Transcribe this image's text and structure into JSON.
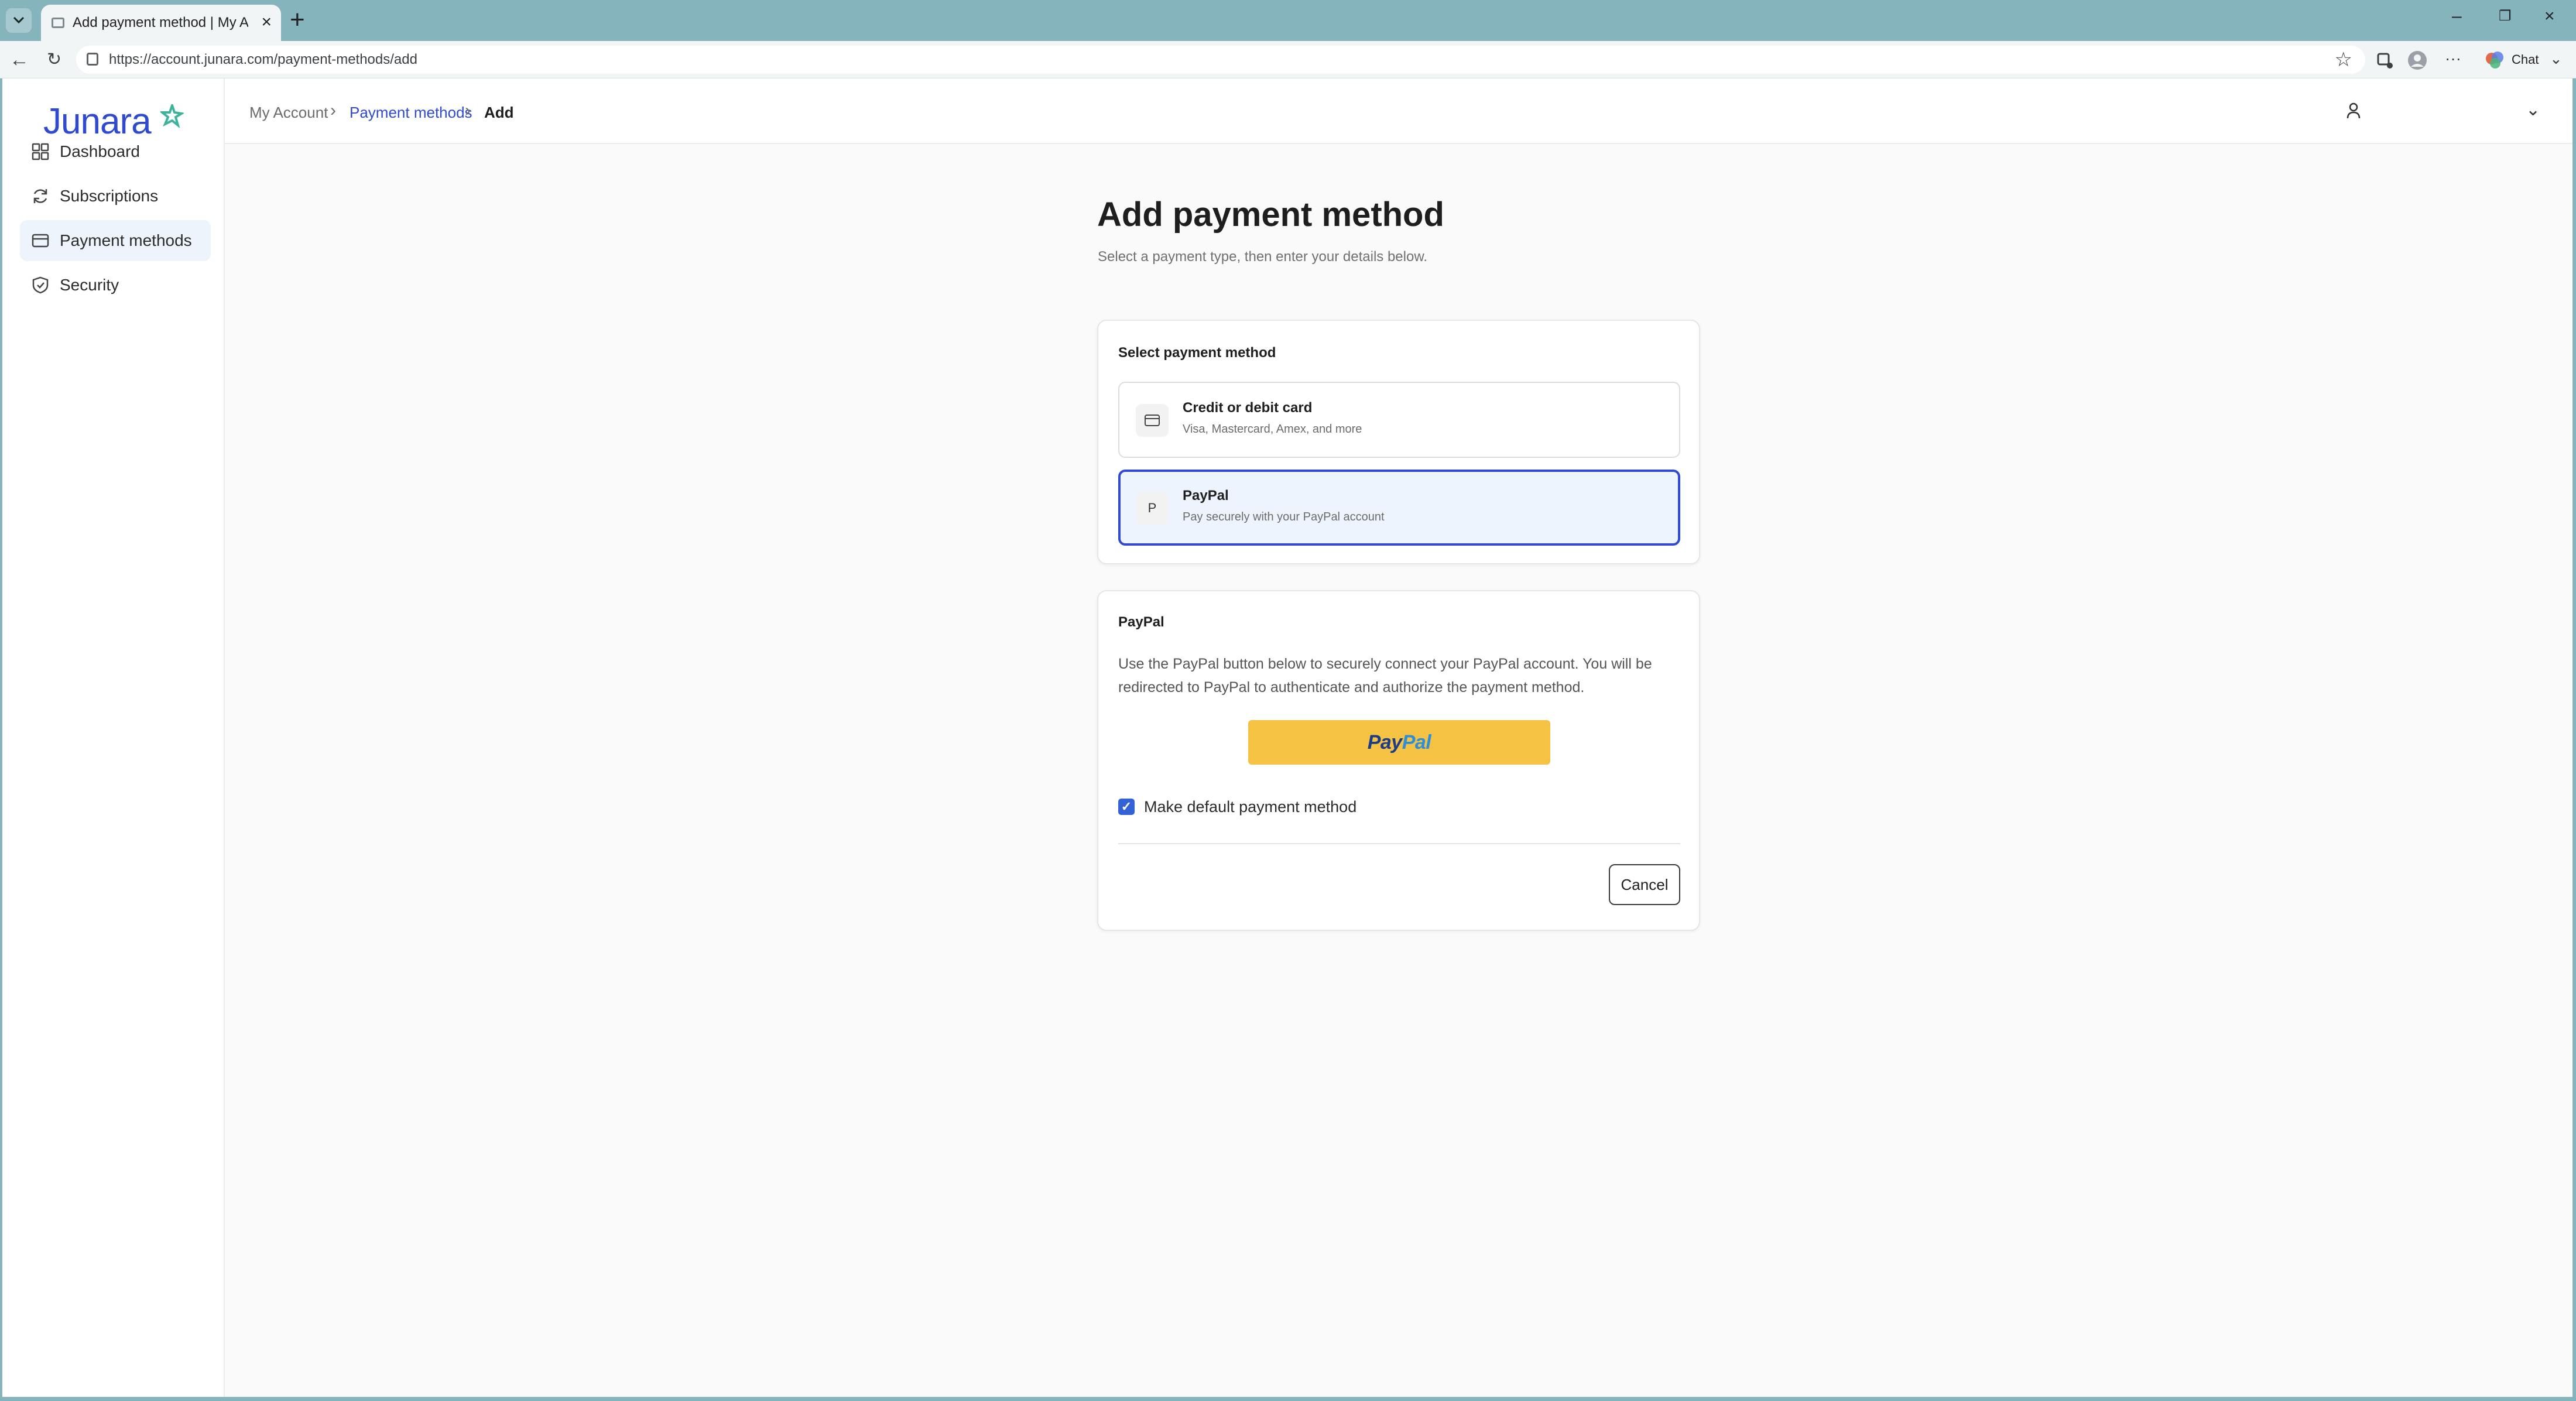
{
  "browser": {
    "tab_title": "Add payment method | My Account",
    "tab_close": "×",
    "new_tab": "+",
    "url": "https://account.junara.com/payment-methods/add",
    "chat_label": "Chat",
    "window_controls": {
      "minimize": "–",
      "restore": "❐",
      "close": "×"
    },
    "nav": {
      "back": "←",
      "reload": "↻",
      "star": "☆",
      "more": "···",
      "chevron": "⌄"
    }
  },
  "sidebar": {
    "logo": "Junara",
    "brand_color": "#2f4ad0",
    "items": [
      {
        "label": "Dashboard",
        "icon": "dashboard-icon",
        "active": false
      },
      {
        "label": "Subscriptions",
        "icon": "refresh-icon",
        "active": false
      },
      {
        "label": "Payment methods",
        "icon": "credit-card-icon",
        "active": true
      },
      {
        "label": "Security",
        "icon": "shield-icon",
        "active": false
      }
    ]
  },
  "breadcrumb": {
    "items": [
      "My Account",
      "Payment methods",
      "Add"
    ],
    "separator": "›"
  },
  "header": {
    "user_icon": "user-icon",
    "chevron": "⌄"
  },
  "page": {
    "title": "Add payment method",
    "subtitle": "Select a payment type, then enter your details below."
  },
  "select_card": {
    "heading": "Select payment method",
    "options": [
      {
        "title": "Credit or debit card",
        "description": "Visa, Mastercard, Amex, and more",
        "icon": "credit-card-icon",
        "selected": false
      },
      {
        "title": "PayPal",
        "description": "Pay securely with your PayPal account",
        "icon_text": "P",
        "selected": true
      }
    ]
  },
  "paypal_card": {
    "heading": "PayPal",
    "text": "Use the PayPal button below to securely connect your PayPal account. You will be redirected to PayPal to authenticate and authorize the payment method.",
    "button_pay": "Pay",
    "button_pal": "Pal",
    "button_color": "#f5c244",
    "default_checked": true,
    "checkmark": "✓",
    "default_label": "Make default payment method",
    "cancel_label": "Cancel"
  }
}
